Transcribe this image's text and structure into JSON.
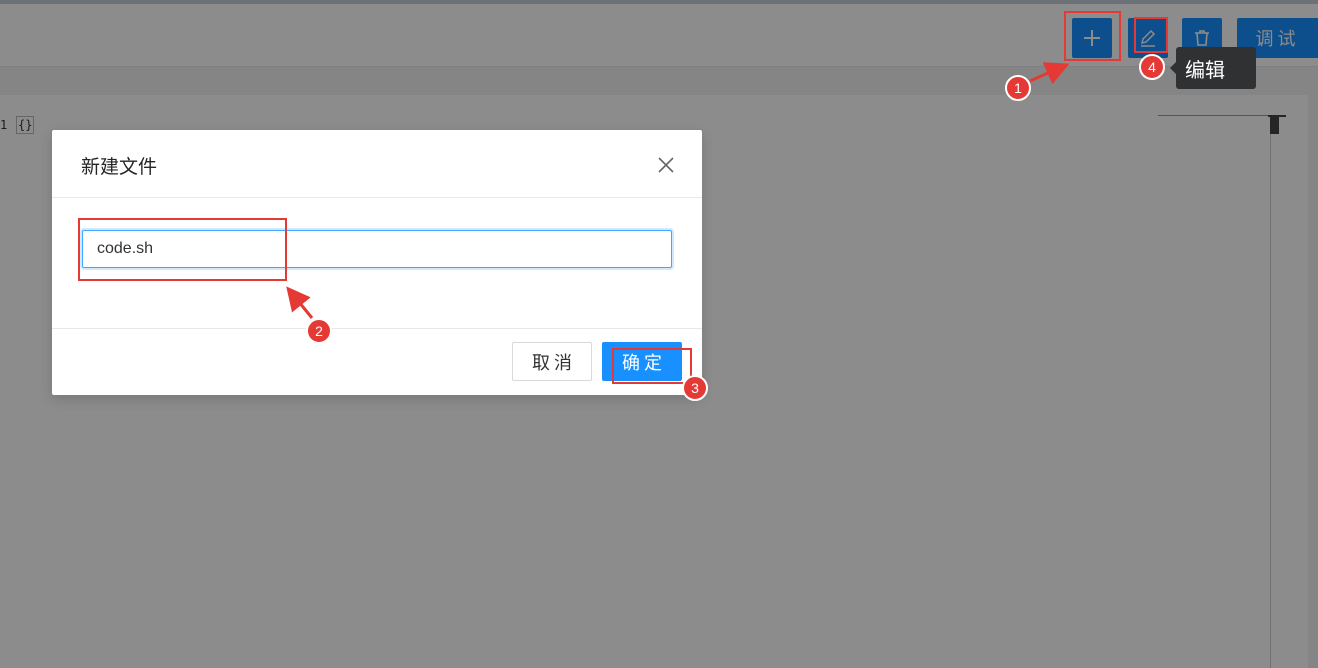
{
  "toolbar": {
    "add_icon": "plus-icon",
    "edit_icon": "pencil-icon",
    "delete_icon": "trash-icon",
    "debug_label": "调试"
  },
  "editor": {
    "line_number": "1",
    "content": "{}"
  },
  "tooltip": {
    "text": "编辑"
  },
  "dialog": {
    "title": "新建文件",
    "close_icon": "close-icon",
    "filename_value": "code.sh",
    "cancel_label": "取消",
    "ok_label": "确定"
  },
  "annotations": {
    "color": "#e53935",
    "steps": [
      "1",
      "2",
      "3",
      "4"
    ]
  },
  "colors": {
    "primary": "#1890ff",
    "tooltip_bg": "#303133"
  }
}
